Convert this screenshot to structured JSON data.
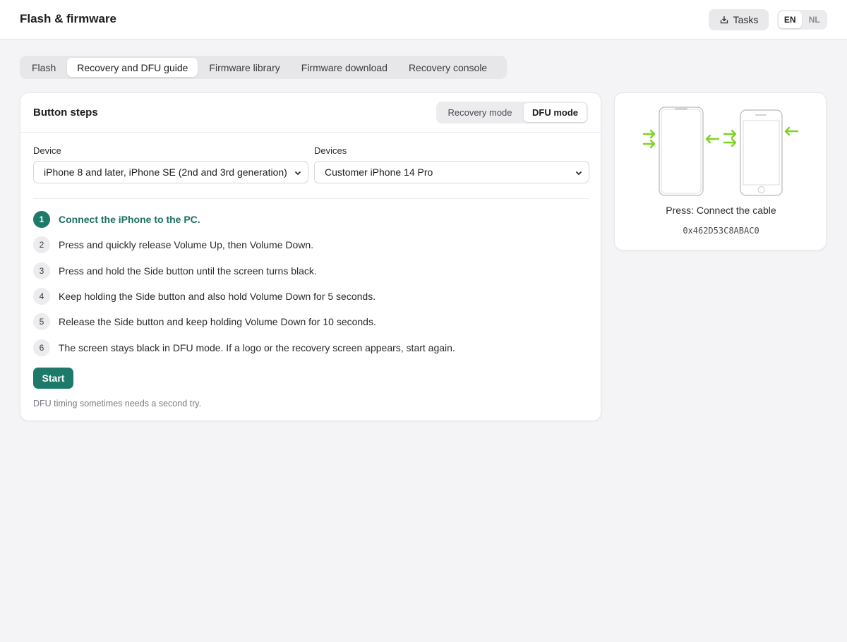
{
  "header": {
    "title": "Flash & firmware",
    "tasks_label": "Tasks",
    "languages": [
      "EN",
      "NL"
    ],
    "active_language": "EN"
  },
  "tabs": [
    {
      "label": "Flash",
      "active": false
    },
    {
      "label": "Recovery and DFU guide",
      "active": true
    },
    {
      "label": "Firmware library",
      "active": false
    },
    {
      "label": "Firmware download",
      "active": false
    },
    {
      "label": "Recovery console",
      "active": false
    }
  ],
  "guide": {
    "title": "Button steps",
    "modes": [
      "Recovery mode",
      "DFU mode"
    ],
    "active_mode": "DFU mode",
    "device_label": "Device",
    "device_value": "iPhone 8 and later, iPhone SE (2nd and 3rd generation)",
    "devices_label": "Devices",
    "devices_value": "Customer iPhone 14 Pro",
    "steps": [
      {
        "num": "1",
        "text": "Connect the iPhone to the PC.",
        "active": true
      },
      {
        "num": "2",
        "text": "Press and quickly release Volume Up, then Volume Down.",
        "active": false
      },
      {
        "num": "3",
        "text": "Press and hold the Side button until the screen turns black.",
        "active": false
      },
      {
        "num": "4",
        "text": "Keep holding the Side button and also hold Volume Down for 5 seconds.",
        "active": false
      },
      {
        "num": "5",
        "text": "Release the Side button and keep holding Volume Down for 10 seconds.",
        "active": false
      },
      {
        "num": "6",
        "text": "The screen stays black in DFU mode. If a logo or the recovery screen appears, start again.",
        "active": false
      }
    ],
    "start_label": "Start",
    "note": "DFU timing sometimes needs a second try."
  },
  "illustration": {
    "press_text": "Press: Connect the cable",
    "device_id": "0x462D53C8ABAC0",
    "arrow_color": "#7ed321"
  },
  "colors": {
    "accent": "#1d7a6b",
    "background": "#f4f4f6"
  }
}
